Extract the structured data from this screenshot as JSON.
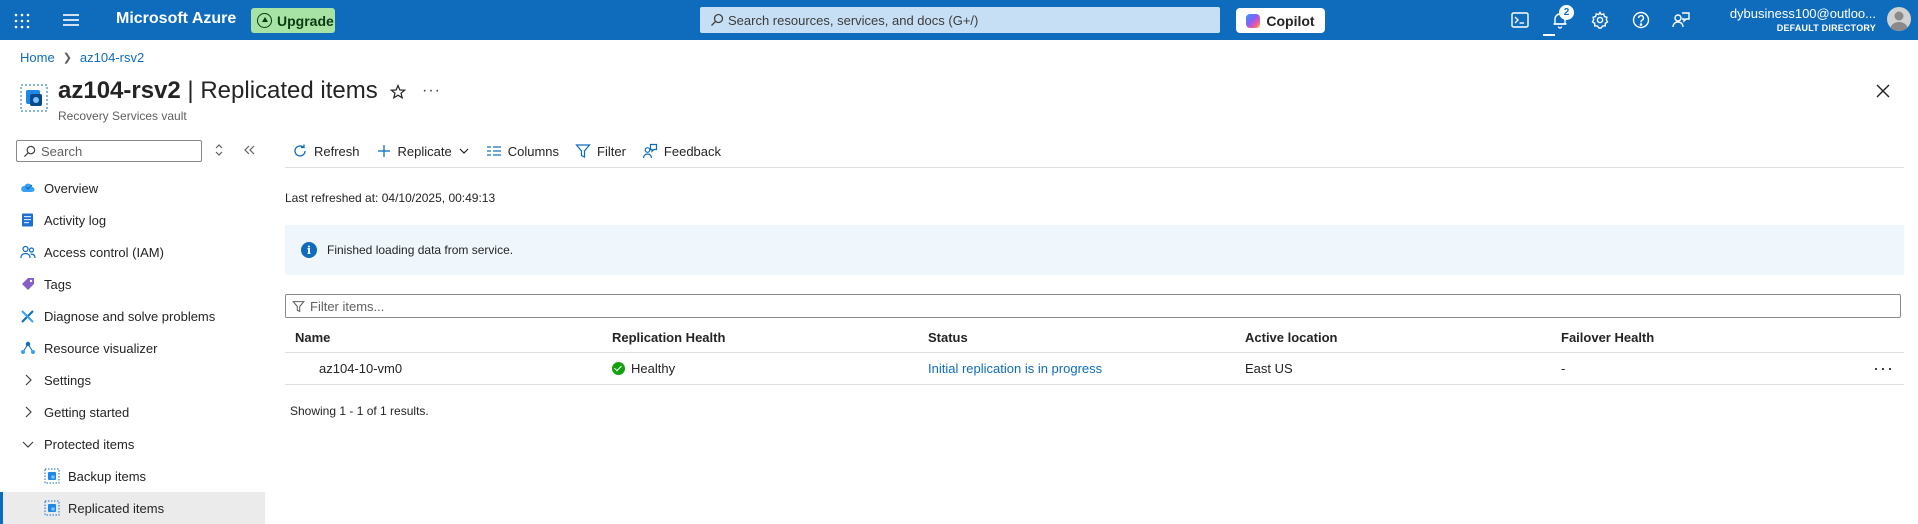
{
  "topbar": {
    "brand": "Microsoft Azure",
    "upgrade_label": "Upgrade",
    "search_placeholder": "Search resources, services, and docs (G+/)",
    "copilot_label": "Copilot",
    "notification_count": "2",
    "account_user": "dybusiness100@outloo...",
    "account_directory": "DEFAULT DIRECTORY"
  },
  "breadcrumb": {
    "home": "Home",
    "vault": "az104-rsv2"
  },
  "header": {
    "vault_name": "az104-rsv2",
    "separator": " | ",
    "page_name": "Replicated items",
    "subtitle": "Recovery Services vault"
  },
  "sidebar": {
    "search_placeholder": "Search",
    "items": [
      {
        "label": "Overview",
        "icon": "cloud-icon"
      },
      {
        "label": "Activity log",
        "icon": "activity-log-icon"
      },
      {
        "label": "Access control (IAM)",
        "icon": "people-icon"
      },
      {
        "label": "Tags",
        "icon": "tag-icon"
      },
      {
        "label": "Diagnose and solve problems",
        "icon": "wrench-icon"
      },
      {
        "label": "Resource visualizer",
        "icon": "visualizer-icon"
      },
      {
        "label": "Settings",
        "icon": "chevron-right-icon"
      },
      {
        "label": "Getting started",
        "icon": "chevron-right-icon"
      },
      {
        "label": "Protected items",
        "icon": "chevron-down-icon"
      },
      {
        "label": "Backup items",
        "icon": "vault-icon"
      },
      {
        "label": "Replicated items",
        "icon": "vault-icon"
      }
    ]
  },
  "toolbar": {
    "refresh": "Refresh",
    "replicate": "Replicate",
    "columns": "Columns",
    "filter": "Filter",
    "feedback": "Feedback"
  },
  "main": {
    "last_refreshed": "Last refreshed at: 04/10/2025, 00:49:13",
    "info_message": "Finished loading data from service.",
    "filter_placeholder": "Filter items...",
    "columns": [
      "Name",
      "Replication Health",
      "Status",
      "Active location",
      "Failover Health"
    ],
    "rows": [
      {
        "name": "az104-10-vm0",
        "health": "Healthy",
        "status": "Initial replication is in progress",
        "location": "East US",
        "failover": "-"
      }
    ],
    "results": "Showing 1 - 1 of 1 results."
  },
  "colors": {
    "accent": "#0f6cbd",
    "healthy": "#13a10e",
    "info_bg": "#eff6fc"
  }
}
